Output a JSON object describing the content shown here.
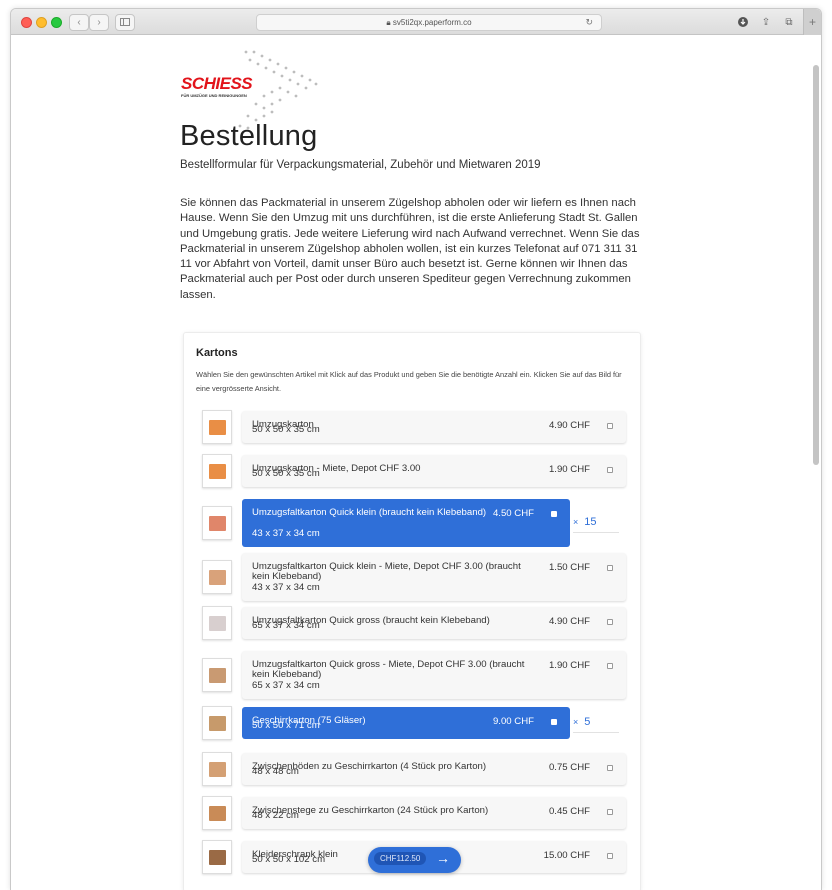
{
  "browser": {
    "url": "sv5ti2qx.paperform.co",
    "nav_back": "‹",
    "nav_forward": "›",
    "sidebar_icon": "sidebar-icon",
    "reload_icon": "reload-icon",
    "downloads_icon": "downloads-icon",
    "share_icon": "share-icon",
    "tabs_icon": "tabs-icon",
    "new_tab": "+"
  },
  "logo": {
    "name": "SCHIESS",
    "tagline": "FÜR UMZÜGE UND REINIGUNGEN"
  },
  "page": {
    "title": "Bestellung",
    "subtitle": "Bestellformular für Verpackungsmaterial, Zubehör und Mietwaren 2019",
    "intro": "Sie können  das Packmaterial in unserem Zügelshop abholen oder wir liefern es Ihnen nach Hause. Wenn Sie den Umzug mit uns durchführen, ist die erste Anlieferung Stadt St. Gallen und Umgebung gratis. Jede weitere Lieferung wird nach Aufwand verrechnet.  Wenn Sie das Packmaterial in unserem Zügelshop abholen wollen, ist ein kurzes Telefonat auf 071 311 31 11 vor Abfahrt von Vorteil, damit unser Büro auch besetzt ist. Gerne können wir Ihnen das Packmaterial auch per Post oder durch unseren Spediteur gegen Verrechnung zukommen lassen."
  },
  "section": {
    "title": "Kartons",
    "description": "Wählen Sie den gewünschten Artikel mit Klick auf das Produkt und geben Sie die benötigte Anzahl ein. Klicken Sie auf das Bild für eine vergrösserte Ansicht."
  },
  "products": [
    {
      "name": "Umzugskarton",
      "size": "50 x 50 x 35 cm",
      "price": "4.90 CHF",
      "selected": false,
      "quantity": ""
    },
    {
      "name": "Umzugskarton - Miete, Depot CHF 3.00",
      "size": "50 x 50 x 35 cm",
      "price": "1.90 CHF",
      "selected": false,
      "quantity": ""
    },
    {
      "name": "Umzugsfaltkarton Quick klein (braucht kein Klebeband)",
      "size": "43 x 37 x 34 cm",
      "price": "4.50 CHF",
      "selected": true,
      "quantity": "15"
    },
    {
      "name": "Umzugsfaltkarton Quick klein - Miete, Depot CHF 3.00 (braucht kein Klebeband)",
      "size": "43 x 37 x 34 cm",
      "price": "1.50 CHF",
      "selected": false,
      "quantity": ""
    },
    {
      "name": "Umzugsfaltkarton Quick gross (braucht kein Klebeband)",
      "size": "65 x 37 x 34 cm",
      "price": "4.90 CHF",
      "selected": false,
      "quantity": ""
    },
    {
      "name": "Umzugsfaltkarton Quick gross - Miete, Depot CHF 3.00 (braucht kein Klebeband)",
      "size": "65 x 37 x 34 cm",
      "price": "1.90 CHF",
      "selected": false,
      "quantity": ""
    },
    {
      "name": "Geschirrkarton (75 Gläser)",
      "size": "50 x 50 x 71 cm",
      "price": "9.00 CHF",
      "selected": true,
      "quantity": "5"
    },
    {
      "name": "Zwischenböden zu Geschirrkarton (4 Stück pro Karton)",
      "size": "48 x 48 cm",
      "price": "0.75 CHF",
      "selected": false,
      "quantity": ""
    },
    {
      "name": "Zwischenstege zu Geschirrkarton (24 Stück pro Karton)",
      "size": "48 x 22 cm",
      "price": "0.45 CHF",
      "selected": false,
      "quantity": ""
    },
    {
      "name": "Kleiderschrank klein",
      "size": "50 x 50 x 102 cm",
      "price": "15.00 CHF",
      "selected": false,
      "quantity": ""
    }
  ],
  "quantity_prefix": "×",
  "total": {
    "amount": "CHF112.50",
    "arrow": "→"
  },
  "colors": {
    "accent": "#2f6fd8",
    "brand_red": "#e2141b"
  }
}
